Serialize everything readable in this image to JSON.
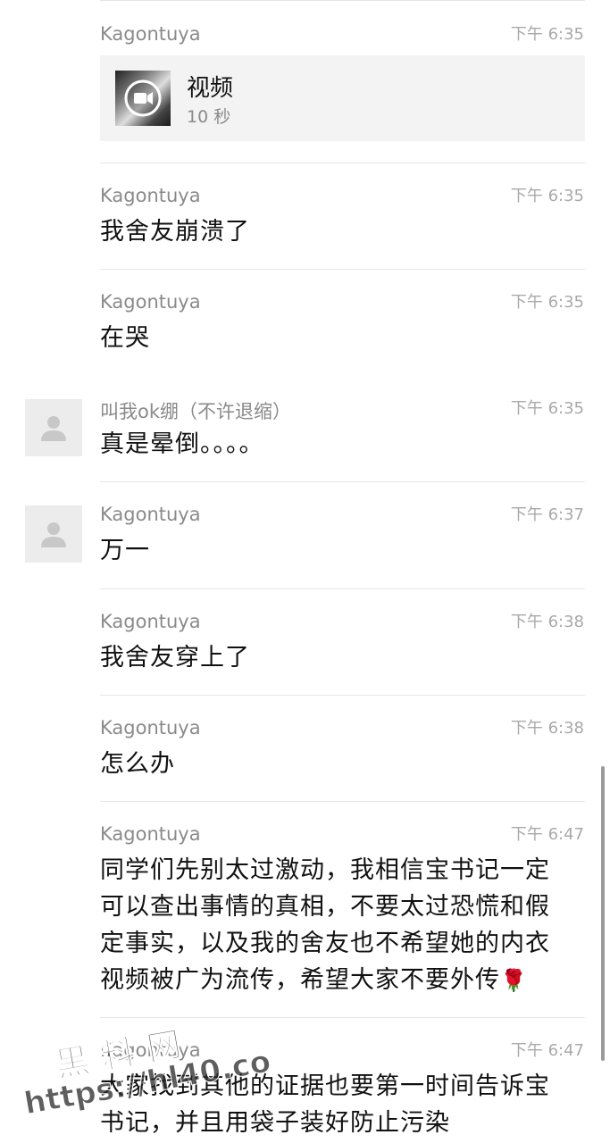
{
  "messages": [
    {
      "sender": "Kagontuya",
      "time": "下午 6:35",
      "type": "video",
      "video_title": "视频",
      "video_duration": "10 秒",
      "avatar": false
    },
    {
      "sender": "Kagontuya",
      "time": "下午 6:35",
      "type": "text",
      "text": "我舍友崩溃了",
      "avatar": false
    },
    {
      "sender": "Kagontuya",
      "time": "下午 6:35",
      "type": "text",
      "text": "在哭",
      "avatar": false
    },
    {
      "sender": "叫我ok绷（不许退缩）",
      "time": "下午 6:35",
      "type": "text",
      "text": "真是晕倒。。。。",
      "avatar": true
    },
    {
      "sender": "Kagontuya",
      "time": "下午 6:37",
      "type": "text",
      "text": "万一",
      "avatar": true
    },
    {
      "sender": "Kagontuya",
      "time": "下午 6:38",
      "type": "text",
      "text": "我舍友穿上了",
      "avatar": false
    },
    {
      "sender": "Kagontuya",
      "time": "下午 6:38",
      "type": "text",
      "text": "怎么办",
      "avatar": false
    },
    {
      "sender": "Kagontuya",
      "time": "下午 6:47",
      "type": "text",
      "text": "同学们先别太过激动，我相信宝书记一定可以查出事情的真相，不要太过恐慌和假定事实，以及我的舍友也不希望她的内衣视频被广为流传，希望大家不要外传",
      "emoji": "🌹",
      "avatar": false
    },
    {
      "sender": "Kagontuya",
      "time": "下午 6:47",
      "type": "text",
      "text": "大家找到其他的证据也要第一时间告诉宝书记，并且用袋子装好防止污染",
      "avatar": false
    }
  ],
  "watermark": {
    "line1": "黑料网",
    "line2": "https://hl40.co"
  },
  "icons": {
    "avatar": "default-avatar-icon",
    "video": "video-camera-icon"
  }
}
